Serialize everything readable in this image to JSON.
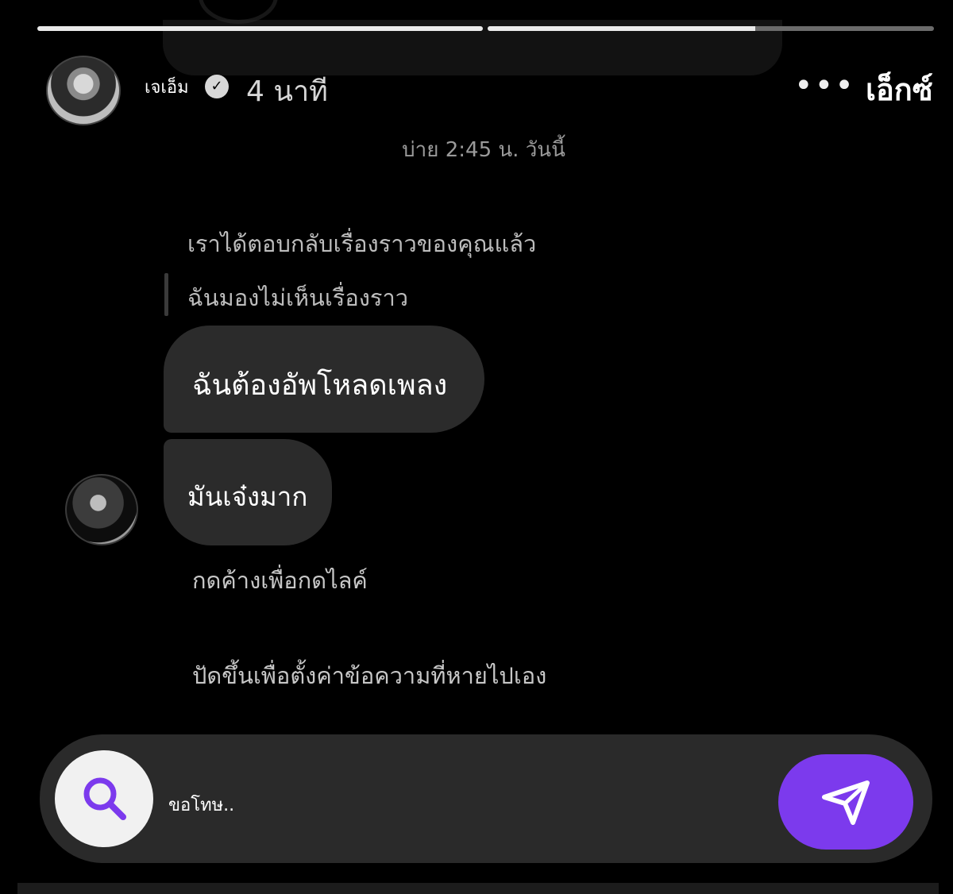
{
  "story": {
    "progress_segments": [
      {
        "filled": 1.0
      },
      {
        "filled": 0.6
      }
    ]
  },
  "header": {
    "username": "เจเอ็ม",
    "time_ago": "4 นาที",
    "more_icon": "more-horizontal-icon",
    "close_label": "เอ็กซ์"
  },
  "chat": {
    "timestamp": "บ่าย 2:45 น. วันนี้",
    "story_reply_notice": "เราได้ตอบกลับเรื่องราวของคุณแล้ว",
    "story_unavailable": "ฉันมองไม่เห็นเรื่องราว",
    "messages": [
      {
        "text": "ฉันต้องอัพโหลดเพลง"
      },
      {
        "text": "มันเจ๋งมาก"
      }
    ],
    "hints": {
      "like": "กดค้างเพื่อกดไลค์",
      "vanish": "ปัดขึ้นเพื่อตั้งค่าข้อความที่หายไปเอง"
    }
  },
  "composer": {
    "input_value": "ขอโทษ..",
    "search_icon": "search-icon",
    "send_icon": "send-icon",
    "accent_color": "#7c3aed"
  }
}
